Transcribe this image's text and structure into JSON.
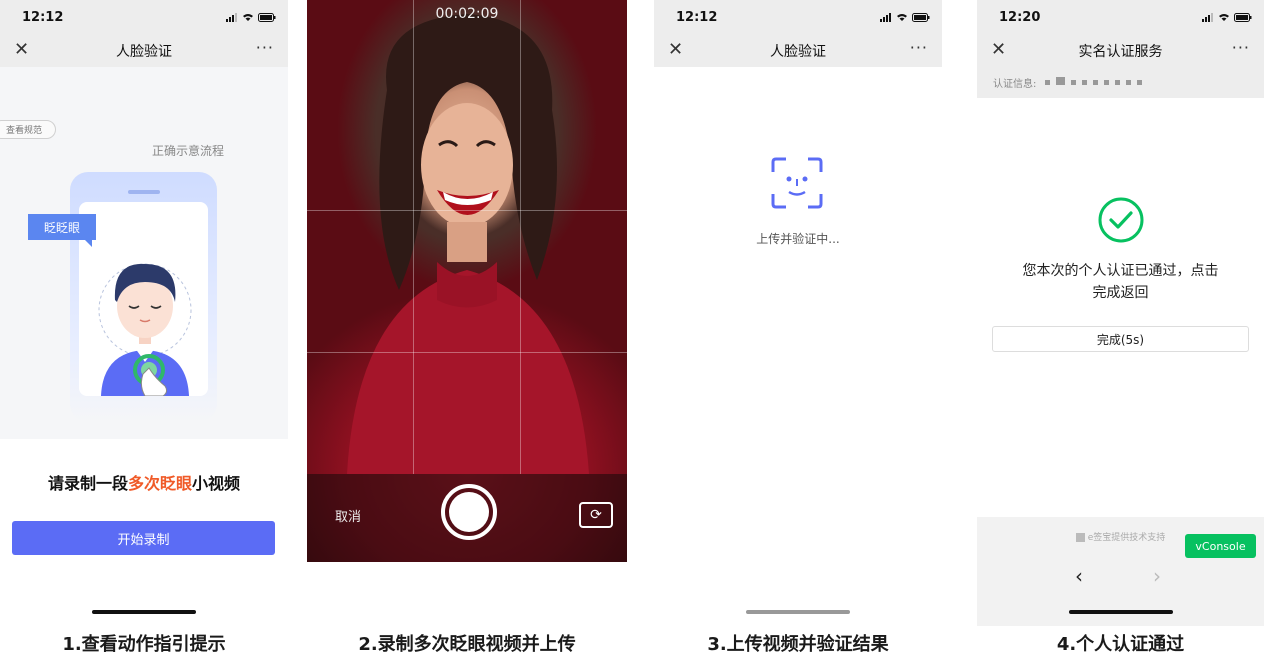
{
  "panel1": {
    "time": "12:12",
    "title": "人脸验证",
    "more": "···",
    "spec_button": "查看规范",
    "flow_label": "正确示意流程",
    "action_tag": "眨眨眼",
    "prompt_before": "请录制一段",
    "prompt_highlight": "多次眨眼",
    "prompt_after": "小视频",
    "start_button": "开始录制"
  },
  "panel2": {
    "timer": "00:02:09",
    "cancel": "取消"
  },
  "panel3": {
    "time": "12:12",
    "title": "人脸验证",
    "more": "···",
    "status": "上传并验证中..."
  },
  "panel4": {
    "time": "12:20",
    "title": "实名认证服务",
    "more": "···",
    "cert_label": "认证信息:",
    "success_line1": "您本次的个人认证已通过，点击",
    "success_line2": "完成返回",
    "done_button": "完成(5s)",
    "provider": "e签宝提供技术支持",
    "vconsole": "vConsole"
  },
  "captions": [
    "1.查看动作指引提示",
    "2.录制多次眨眼视频并上传",
    "3.上传视频并验证结果",
    "4.个人认证通过"
  ],
  "colors": {
    "accent_blue": "#5b6cf5",
    "highlight_orange": "#f05a28",
    "success_green": "#07c160"
  }
}
